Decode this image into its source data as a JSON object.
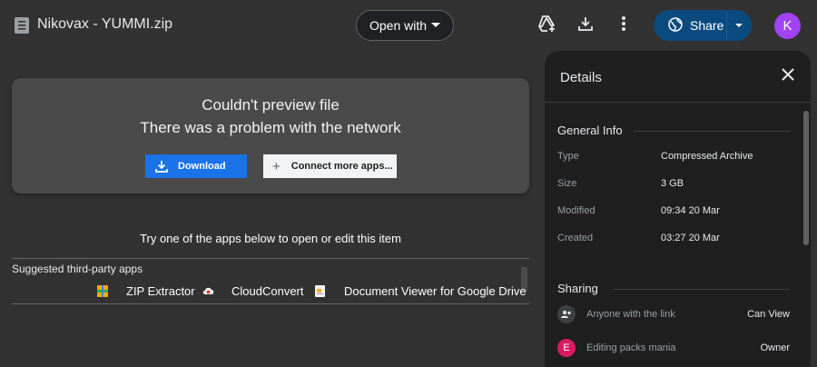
{
  "header": {
    "file_name": "Nikovax - YUMMI.zip",
    "open_with_label": "Open with",
    "share_label": "Share",
    "avatar_initial": "K",
    "avatar_color": "#a142f4",
    "share_color": "#0b4a7f"
  },
  "error": {
    "line1": "Couldn't preview file",
    "line2": "There was a problem with the network",
    "download_label": "Download",
    "connect_label": "Connect more apps...",
    "download_color": "#1a73e8"
  },
  "suggest": {
    "try_text": "Try one of the apps below to open or edit this item",
    "label": "Suggested third-party apps",
    "apps": [
      {
        "name": "ZIP Extractor",
        "icon": "zip-extractor-icon"
      },
      {
        "name": "CloudConvert",
        "icon": "cloudconvert-icon"
      },
      {
        "name": "Document Viewer for Google Drive",
        "icon": "document-viewer-icon"
      }
    ]
  },
  "details": {
    "title": "Details",
    "general_title": "General Info",
    "rows": [
      {
        "key": "Type",
        "value": "Compressed Archive"
      },
      {
        "key": "Size",
        "value": "3 GB"
      },
      {
        "key": "Modified",
        "value": "09:34 20 Mar"
      },
      {
        "key": "Created",
        "value": "03:27 20 Mar"
      }
    ],
    "sharing_title": "Sharing",
    "sharing": [
      {
        "name": "Anyone with the link",
        "role": "Can View",
        "icon": "link-people-icon"
      },
      {
        "name": "Editing packs mania",
        "role": "Owner",
        "initial": "E",
        "color": "#d81b60"
      }
    ]
  }
}
